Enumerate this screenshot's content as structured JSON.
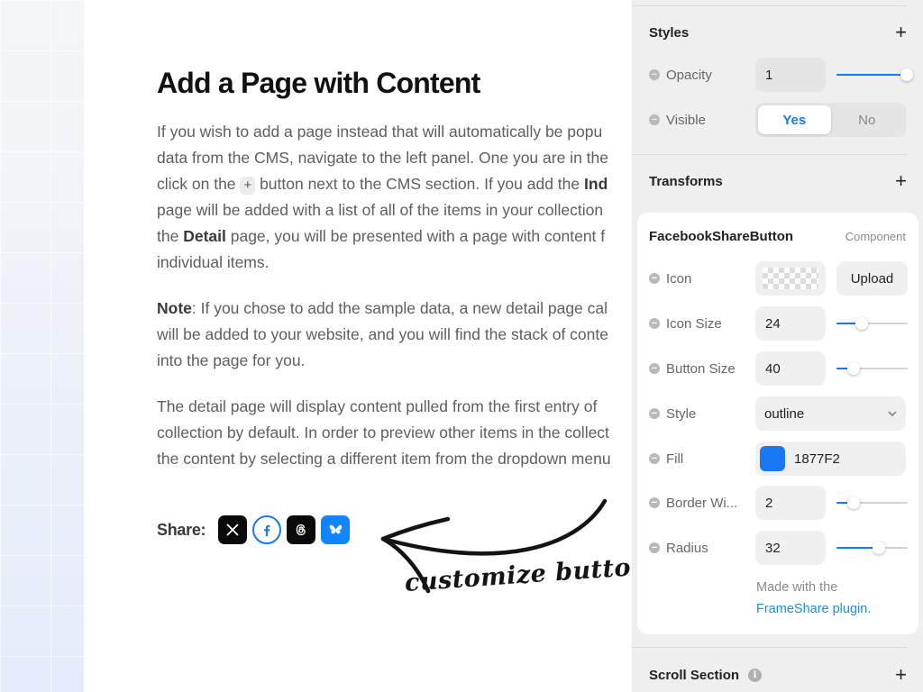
{
  "document": {
    "title": "Add a Page with Content",
    "p1": {
      "l1": "If you wish to add a page instead that will automatically be popu",
      "l2": "data from the CMS, navigate to the left panel. One you are in the",
      "l3a": "click on the",
      "l3kbd": "+",
      "l3b": "button next to the CMS section. If you add the",
      "l3bold": "Ind",
      "l4": "page will be added with a list of all of the items in your collection",
      "l5a": "the",
      "l5bold": "Detail",
      "l5b": "page, you will be presented with a page with content f",
      "l6": "individual items."
    },
    "p2": {
      "l1bold": "Note",
      "l1": ": If you chose to add the sample data, a new detail page cal",
      "l2": "will be added to your website, and you will find the stack of conte",
      "l3": "into the page for you."
    },
    "p3": {
      "l1": "The detail page will display content pulled from the first entry of",
      "l2": "collection by default. In order to preview other items in the collect",
      "l3": "the content by selecting a different item from the dropdown menu"
    },
    "share_label": "Share:",
    "annotation": "customize buttons"
  },
  "panel": {
    "styles": {
      "title": "Styles",
      "opacity_label": "Opacity",
      "opacity_value": "1",
      "opacity_level": 1.0,
      "visible_label": "Visible",
      "visible_yes": "Yes",
      "visible_no": "No"
    },
    "transforms_title": "Transforms",
    "component": {
      "name": "FacebookShareButton",
      "tag": "Component",
      "icon_label": "Icon",
      "upload_label": "Upload",
      "icon_size_label": "Icon Size",
      "icon_size_value": "24",
      "icon_size_level": 0.36,
      "button_size_label": "Button Size",
      "button_size_value": "40",
      "button_size_level": 0.24,
      "style_label": "Style",
      "style_value": "outline",
      "fill_label": "Fill",
      "fill_value": "1877F2",
      "fill_color": "#1877F2",
      "border_label": "Border Wi...",
      "border_value": "2",
      "border_level": 0.24,
      "radius_label": "Radius",
      "radius_value": "32",
      "radius_level": 0.6,
      "made_with": "Made with the",
      "plugin_link": "FrameShare plugin."
    },
    "scroll_section_title": "Scroll Section"
  },
  "colors": {
    "accent": "#1877F2",
    "x": "#0a0a0a",
    "threads": "#0a0a0a",
    "bluesky": "#1185fe"
  }
}
